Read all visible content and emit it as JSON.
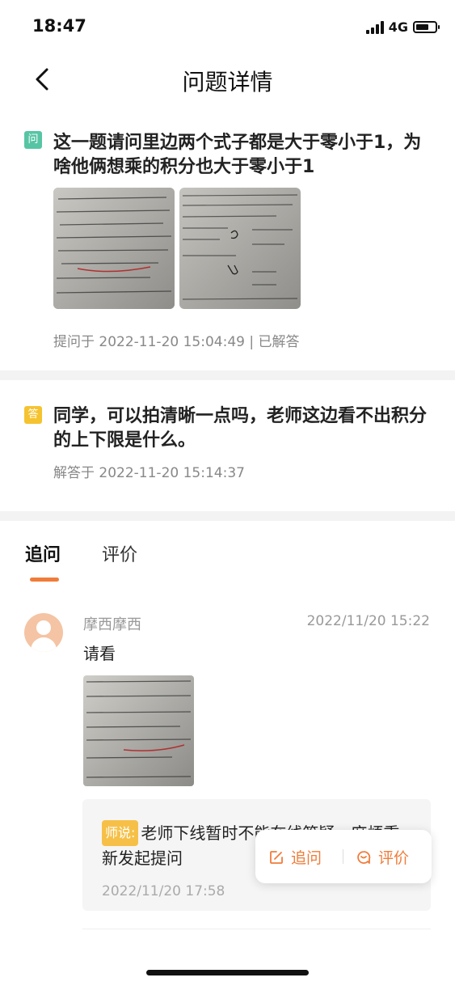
{
  "status_bar": {
    "time": "18:47",
    "network": "4G"
  },
  "nav": {
    "title": "问题详情",
    "back_icon": "chevron-left-icon"
  },
  "question": {
    "badge": "问",
    "text": "这一题请问里边两个式子都是大于零小于1，为啥他俩想乘的积分也大于零小于1",
    "meta": "提问于 2022-11-20 15:04:49 | 已解答"
  },
  "answer": {
    "badge": "答",
    "text": "同学，可以拍清晰一点吗，老师这边看不出积分的上下限是什么。",
    "meta": "解答于 2022-11-20 15:14:37"
  },
  "tabs": [
    {
      "label": "追问",
      "active": true
    },
    {
      "label": "评价",
      "active": false
    }
  ],
  "followup": {
    "user_name": "摩西摩西",
    "time": "2022/11/20 15:22",
    "text": "请看",
    "reply": {
      "tag": "师说:",
      "text": "老师下线暂时不能在线答疑，麻烦重新发起提问",
      "time": "2022/11/20 17:58"
    }
  },
  "popup": {
    "ask_label": "追问",
    "rate_label": "评价"
  },
  "colors": {
    "accent": "#f07c3a",
    "question_badge": "#57c5a4",
    "answer_badge": "#f5c330"
  }
}
